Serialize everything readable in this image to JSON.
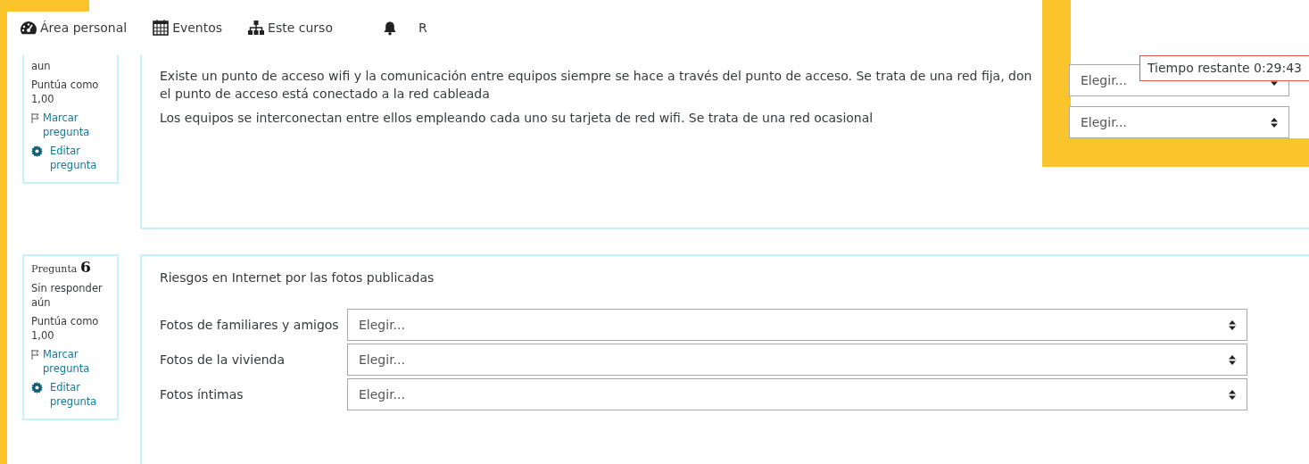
{
  "nav": [
    {
      "kind": "dashboard",
      "label": "Área personal"
    },
    {
      "kind": "calendar",
      "label": "Eventos"
    },
    {
      "kind": "sitemap",
      "label": "Este curso"
    },
    {
      "kind": "bell"
    },
    {
      "kind": "text",
      "label": "R"
    }
  ],
  "timer": {
    "text": "Tiempo restante 0:29:43"
  },
  "questions": [
    {
      "kind": "side",
      "info": {
        "status": "aun",
        "marks": "Puntúa como 1,00",
        "flag": "Marcar pregunta",
        "edit": "Editar pregunta"
      },
      "rows": [
        {
          "lines": [
            "Existe un punto de acceso wifi y la comunicación entre equipos siempre se hace a través del punto de acceso. Se trata de una red fija, don",
            "el punto de acceso está conectado a la red cableada"
          ],
          "select": "Elegir..."
        },
        {
          "lines": [
            "Los equipos se interconectan entre ellos empleando cada uno su tarjeta de red wifi. Se trata de una red ocasional"
          ],
          "select": "Elegir..."
        }
      ]
    },
    {
      "kind": "inline",
      "info": {
        "heading": "Pregunta",
        "number": "6",
        "status": "Sin responder aún",
        "marks": "Puntúa como 1,00",
        "flag": "Marcar pregunta",
        "edit": "Editar pregunta"
      },
      "prompt": "Riesgos en Internet por las fotos publicadas",
      "rows": [
        {
          "lines": [
            "Fotos de familiares y amigos"
          ],
          "select": "Elegir..."
        },
        {
          "lines": [
            "Fotos de la vivienda"
          ],
          "select": "Elegir..."
        },
        {
          "lines": [
            "Fotos íntimas"
          ],
          "select": "Elegir..."
        }
      ]
    }
  ]
}
